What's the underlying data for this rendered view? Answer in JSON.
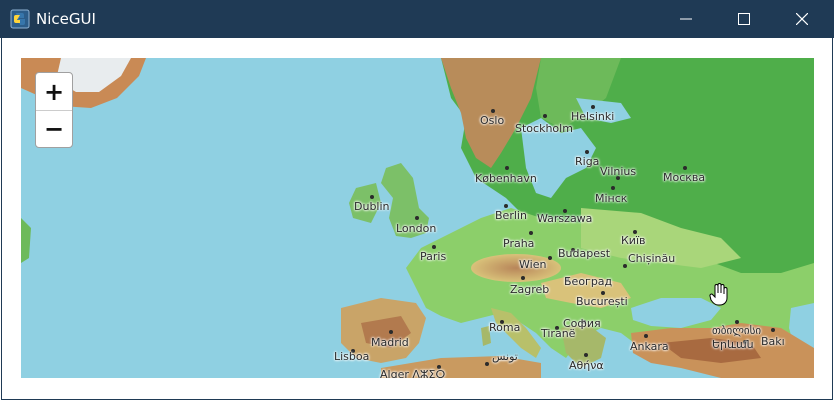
{
  "window": {
    "title": "NiceGUI",
    "app_icon": "python-icon",
    "controls": [
      "minimize-icon",
      "maximize-icon",
      "close-icon"
    ]
  },
  "map": {
    "zoom_in_label": "+",
    "zoom_out_label": "−",
    "cities": [
      {
        "key": "oslo",
        "label": "Oslo"
      },
      {
        "key": "stockholm",
        "label": "Stockholm"
      },
      {
        "key": "helsinki",
        "label": "Helsinki"
      },
      {
        "key": "riga",
        "label": "Riga"
      },
      {
        "key": "vilnius",
        "label": "Vilnius"
      },
      {
        "key": "moskva",
        "label": "Москва"
      },
      {
        "key": "kobenhavn",
        "label": "København"
      },
      {
        "key": "minsk",
        "label": "Мінск"
      },
      {
        "key": "dublin",
        "label": "Dublin"
      },
      {
        "key": "london",
        "label": "London"
      },
      {
        "key": "berlin",
        "label": "Berlin"
      },
      {
        "key": "warszawa",
        "label": "Warszawa"
      },
      {
        "key": "kyiv",
        "label": "Київ"
      },
      {
        "key": "praha",
        "label": "Praha"
      },
      {
        "key": "paris",
        "label": "Paris"
      },
      {
        "key": "budapest",
        "label": "Budapest"
      },
      {
        "key": "wien",
        "label": "Wien"
      },
      {
        "key": "chisinau",
        "label": "Chișinău"
      },
      {
        "key": "beograd",
        "label": "Београд"
      },
      {
        "key": "zagreb",
        "label": "Zagreb"
      },
      {
        "key": "bucuresti",
        "label": "București"
      },
      {
        "key": "roma",
        "label": "Roma"
      },
      {
        "key": "sofia",
        "label": "София"
      },
      {
        "key": "tirane",
        "label": "Tiranë"
      },
      {
        "key": "madrid",
        "label": "Madrid"
      },
      {
        "key": "ankara",
        "label": "Ankara"
      },
      {
        "key": "tbilisi",
        "label": "თბილისი"
      },
      {
        "key": "yerevan",
        "label": "Երևան"
      },
      {
        "key": "baki",
        "label": "Bakı"
      },
      {
        "key": "lisboa",
        "label": "Lisboa"
      },
      {
        "key": "alger",
        "label": "Alger ⴷⵣⵉⵔ"
      },
      {
        "key": "tunis",
        "label": "تونس"
      },
      {
        "key": "athina",
        "label": "Αθήνα"
      }
    ]
  }
}
